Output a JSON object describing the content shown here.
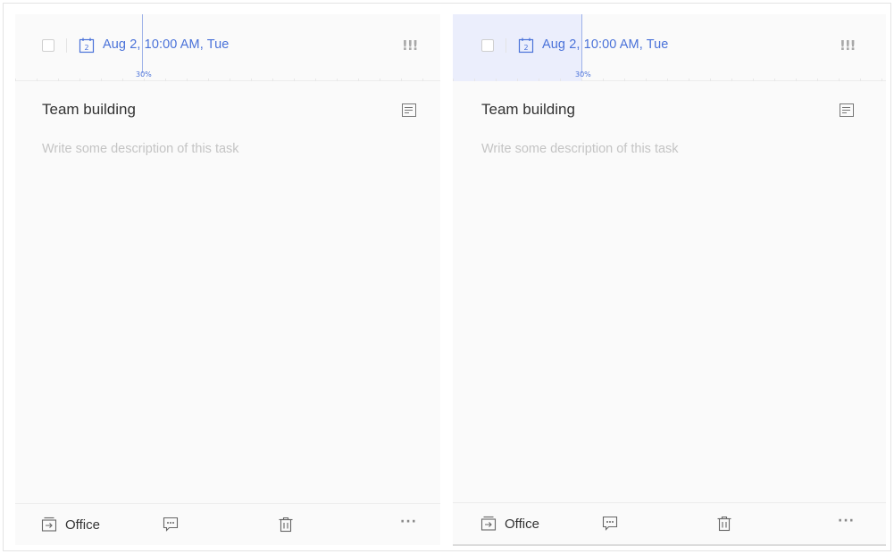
{
  "task": {
    "due": "Aug 2, 10:00 AM, Tue",
    "calendar_day": "2",
    "priority": "!!!",
    "progress_label": "30%",
    "title": "Team building",
    "description_placeholder": "Write some description of this task",
    "list_name": "Office"
  },
  "colors": {
    "accent": "#4a72d9",
    "highlight": "#ebeefc",
    "panel_bg": "#fafafa"
  },
  "icons": {
    "checkbox": "checkbox-icon",
    "calendar": "calendar-icon",
    "priority": "priority-icon",
    "description": "description-icon",
    "list": "list-icon",
    "comment": "comment-icon",
    "delete": "trash-icon",
    "more": "more-icon"
  }
}
